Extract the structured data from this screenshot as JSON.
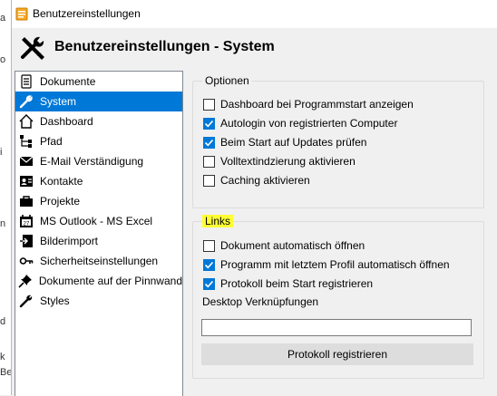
{
  "window": {
    "title": "Benutzereinstellungen"
  },
  "header": {
    "title": "Benutzereinstellungen - System"
  },
  "background_fragments": [
    "a",
    "o",
    "i",
    "n",
    "d",
    "k",
    "Be"
  ],
  "nav": {
    "items": [
      {
        "label": "Dokumente",
        "icon": "document-icon"
      },
      {
        "label": "System",
        "icon": "wrench-icon",
        "selected": true
      },
      {
        "label": "Dashboard",
        "icon": "home-icon"
      },
      {
        "label": "Pfad",
        "icon": "tree-path-icon"
      },
      {
        "label": "E-Mail Verständigung",
        "icon": "email-icon"
      },
      {
        "label": "Kontakte",
        "icon": "contact-card-icon"
      },
      {
        "label": "Projekte",
        "icon": "briefcase-icon"
      },
      {
        "label": "MS Outlook - MS Excel",
        "icon": "calendar-icon"
      },
      {
        "label": "Bilderimport",
        "icon": "image-import-icon"
      },
      {
        "label": "Sicherheitseinstellungen",
        "icon": "key-icon"
      },
      {
        "label": "Dokumente auf der Pinnwand",
        "icon": "pin-icon"
      },
      {
        "label": "Styles",
        "icon": "wrench-icon"
      }
    ]
  },
  "optionen": {
    "legend": "Optionen",
    "options": [
      {
        "label": "Dashboard bei Programmstart anzeigen",
        "checked": false
      },
      {
        "label": "Autologin von registrierten Computer",
        "checked": true
      },
      {
        "label": "Beim Start auf Updates prüfen",
        "checked": true
      },
      {
        "label": "Volltextindzierung aktivieren",
        "checked": false
      },
      {
        "label": "Caching aktivieren",
        "checked": false
      }
    ]
  },
  "links": {
    "legend": "Links",
    "options": [
      {
        "label": "Dokument automatisch öffnen",
        "checked": false
      },
      {
        "label": "Programm mit letztem Profil automatisch öffnen",
        "checked": true
      },
      {
        "label": "Protokoll beim Start registrieren",
        "checked": true
      }
    ],
    "desktop_label": "Desktop Verknüpfungen",
    "desktop_value": "",
    "register_button": "Protokoll registrieren"
  },
  "colors": {
    "accent": "#0078d7",
    "highlight": "#ffff34",
    "button_bg": "#dddddd"
  }
}
